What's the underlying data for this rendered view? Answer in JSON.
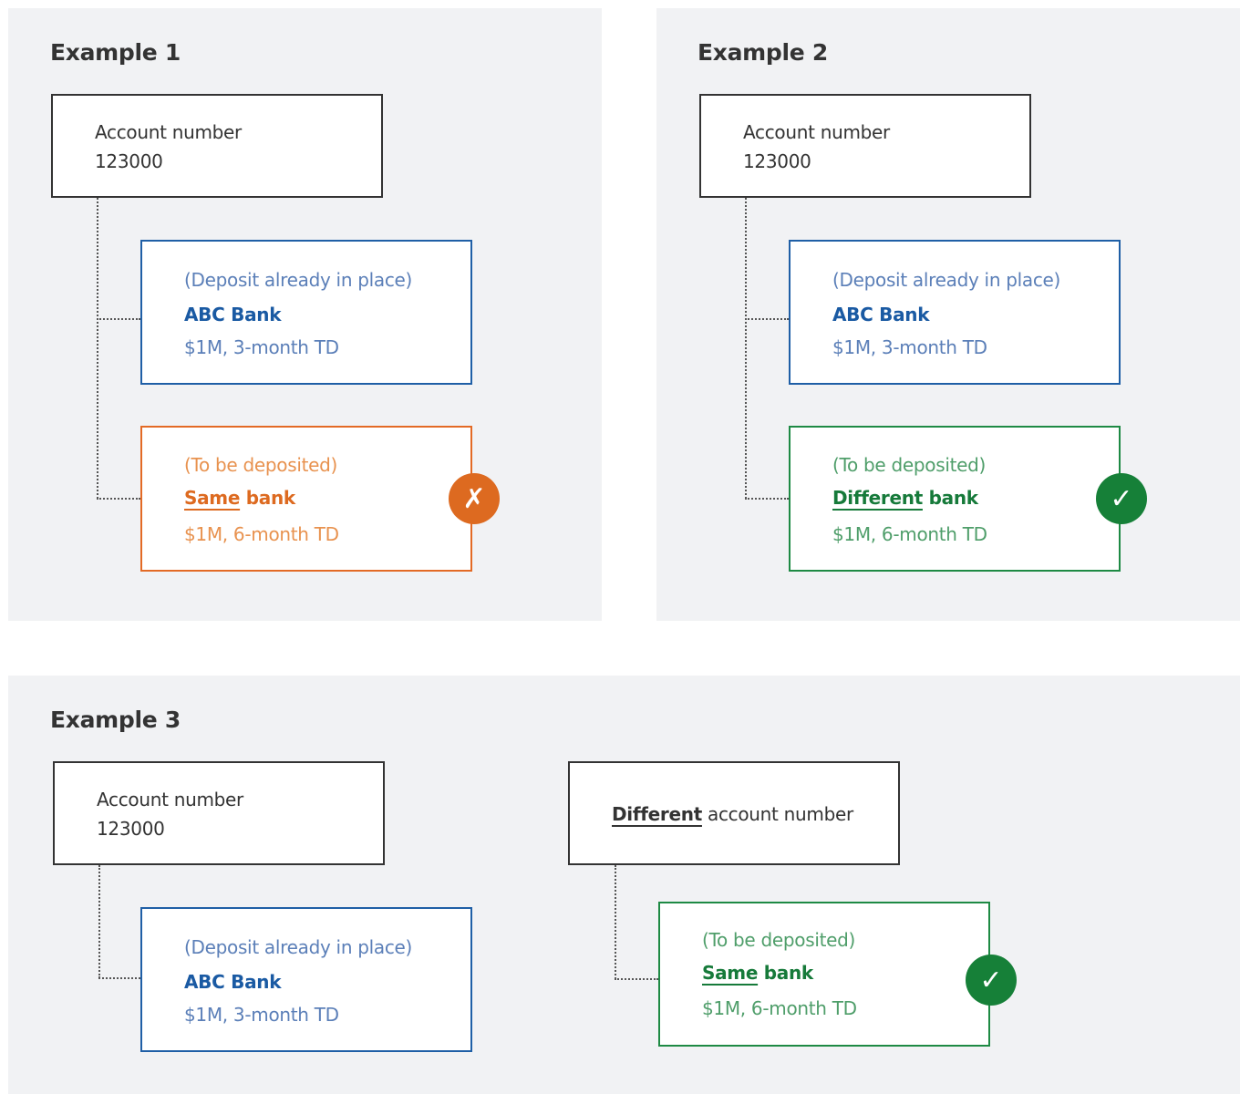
{
  "example1": {
    "title": "Example 1",
    "account_label": "Account number",
    "account_number": "123000",
    "existing": {
      "note": "(Deposit already in place)",
      "bank": "ABC Bank",
      "detail": "$1M, 3-month TD"
    },
    "new": {
      "note": "(To be deposited)",
      "bank_emph": "Same",
      "bank_rest": " bank",
      "detail": "$1M, 6-month TD"
    },
    "result_icon": "cross-icon",
    "result_glyph": "✗"
  },
  "example2": {
    "title": "Example 2",
    "account_label": "Account number",
    "account_number": "123000",
    "existing": {
      "note": "(Deposit already in place)",
      "bank": "ABC Bank",
      "detail": "$1M, 3-month TD"
    },
    "new": {
      "note": "(To be deposited)",
      "bank_emph": "Different",
      "bank_rest": " bank",
      "detail": "$1M, 6-month TD"
    },
    "result_icon": "check-icon",
    "result_glyph": "✓"
  },
  "example3": {
    "title": "Example 3",
    "account_label": "Account number",
    "account_number": "123000",
    "existing": {
      "note": "(Deposit already in place)",
      "bank": "ABC Bank",
      "detail": "$1M, 3-month TD"
    },
    "other_account_emph": "Different",
    "other_account_rest": " account number",
    "new": {
      "note": "(To be deposited)",
      "bank_emph": "Same",
      "bank_rest": " bank",
      "detail": "$1M, 6-month TD"
    },
    "result_icon": "check-icon",
    "result_glyph": "✓"
  },
  "colors": {
    "panel_bg": "#f1f2f4",
    "existing_blue": "#1f5fa6",
    "bad_orange": "#dd6a20",
    "good_green": "#168038"
  }
}
